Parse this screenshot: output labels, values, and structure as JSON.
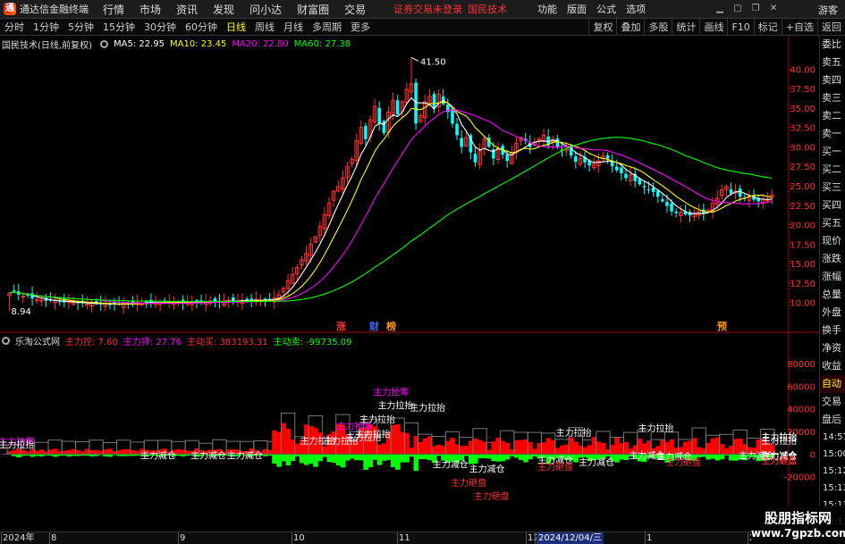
{
  "topbar": {
    "app_title": "通达信金融终端",
    "menus": [
      "行情",
      "市场",
      "资讯",
      "发现",
      "问小达",
      "财富圈",
      "交易"
    ],
    "notice": "证券交易未登录",
    "stock_name": "国民技术",
    "right_menus": [
      "功能",
      "版面",
      "公式",
      "选项"
    ],
    "guest": "游客",
    "brand_color": "#ff3030"
  },
  "toolbar": {
    "periods": [
      "分时",
      "1分钟",
      "5分钟",
      "15分钟",
      "30分钟",
      "60分钟",
      "日线",
      "周线",
      "月线",
      "多周期",
      "更多"
    ],
    "active_period": "日线",
    "right_buttons": [
      "复权",
      "叠加",
      "多股",
      "统计",
      "画线",
      "F10",
      "标记",
      "+自选",
      "返回"
    ]
  },
  "main_info": {
    "label": "国民技术(日线,前复权)",
    "ma5": "MA5: 22.95",
    "ma10": "MA10: 23.45",
    "ma20": "MA20: 22.80",
    "ma60": "MA60: 27.38",
    "colors": {
      "ma5": "#ffffff",
      "ma10": "#ffff00",
      "ma20": "#ff00ff",
      "ma60": "#00ff00"
    }
  },
  "sub_info": {
    "label": "乐淘公式网",
    "zlk": "主力控: 7.60",
    "zlp": "主力排: 27.76",
    "zdm": "主动买: 383193.31",
    "zdmc": "主动卖: -99735.09",
    "colors": {
      "zlk": "#ff3030",
      "zlp": "#ff00ff",
      "zdm": "#ff3030",
      "zdmc": "#00ff00"
    }
  },
  "chart_data": [
    {
      "type": "candlestick",
      "title": "国民技术(日线,前复权)",
      "ylim": [
        8,
        42
      ],
      "yticks": [
        "40.00",
        "37.50",
        "35.00",
        "32.50",
        "30.00",
        "27.50",
        "25.00",
        "22.50",
        "20.00",
        "17.50",
        "15.00",
        "12.50",
        "10.00"
      ],
      "price_high_label": "41.50",
      "price_low_label": "8.94",
      "event_markers": [
        {
          "label": "涨",
          "color": "#ff3030",
          "date": "2024-10"
        },
        {
          "label": "财",
          "color": "#3070ff",
          "date": "2024-10"
        },
        {
          "label": "榜",
          "color": "#ff9900",
          "date": "2024-10"
        },
        {
          "label": "预",
          "color": "#ff9900",
          "date": "2025-01"
        }
      ],
      "closes": [
        11.2,
        11.5,
        11.0,
        10.8,
        10.9,
        10.5,
        10.4,
        10.3,
        10.2,
        10.3,
        10.2,
        10.1,
        10.0,
        10.1,
        10.0,
        9.9,
        9.9,
        9.8,
        9.9,
        9.8,
        9.8,
        9.9,
        9.7,
        9.8,
        9.7,
        9.9,
        9.8,
        9.9,
        10.0,
        9.9,
        10.1,
        10.0,
        9.9,
        9.9,
        10.0,
        10.1,
        9.9,
        10.0,
        9.9,
        10.0,
        10.1,
        10.0,
        10.0,
        10.1,
        10.2,
        10.1,
        10.0,
        10.2,
        10.3,
        10.1,
        10.2,
        10.3,
        10.2,
        10.3,
        10.4,
        10.2,
        10.3,
        10.4,
        10.6,
        11.0,
        11.8,
        12.8,
        13.6,
        14.5,
        15.5,
        16.3,
        17.5,
        18.4,
        19.8,
        21.3,
        22.8,
        24.3,
        24.9,
        26.0,
        27.5,
        28.4,
        30.8,
        32.5,
        31.0,
        33.5,
        35.2,
        33.0,
        31.8,
        34.5,
        36.0,
        34.2,
        35.8,
        37.4,
        38.1,
        33.0,
        34.0,
        35.8,
        36.5,
        35.0,
        36.8,
        35.5,
        34.5,
        33.0,
        31.5,
        30.0,
        31.2,
        29.3,
        28.0,
        29.5,
        31.0,
        30.0,
        28.5,
        29.8,
        29.0,
        28.2,
        29.2,
        30.5,
        31.2,
        30.8,
        30.0,
        30.6,
        31.0,
        31.5,
        30.2,
        31.0,
        30.0,
        29.5,
        29.8,
        28.9,
        28.1,
        28.5,
        28.0,
        27.6,
        27.8,
        28.2,
        28.8,
        28.5,
        27.5,
        27.0,
        26.6,
        26.0,
        26.4,
        25.6,
        25.2,
        24.8,
        24.5,
        24.2,
        23.6,
        23.0,
        22.4,
        21.7,
        21.5,
        21.6,
        21.3,
        21.2,
        21.5,
        21.7,
        21.4,
        21.9,
        22.8,
        23.4,
        24.5,
        24.9,
        24.0,
        24.3,
        23.6,
        23.4,
        23.5,
        23.2,
        23.0,
        23.3,
        23.2,
        23.8
      ],
      "series": [
        {
          "name": "MA5",
          "color": "#ffffff"
        },
        {
          "name": "MA10",
          "color": "#ffff00"
        },
        {
          "name": "MA20",
          "color": "#ff00ff"
        },
        {
          "name": "MA60",
          "color": "#00ff00"
        }
      ]
    },
    {
      "type": "bar",
      "title": "乐淘公式网",
      "ylim": [
        -25000,
        95000
      ],
      "yticks": [
        "80000",
        "60000",
        "40000",
        "20000",
        "0",
        "-20000"
      ],
      "series": [
        {
          "name": "主动买",
          "color": "#ff0000"
        },
        {
          "name": "主动卖",
          "color": "#00ff00"
        }
      ],
      "annotations": [
        {
          "text": "主力抢筹",
          "color": "#ff00ff",
          "bar": 0,
          "value": 8000
        },
        {
          "text": "主力拉抬",
          "color": "#ffffff",
          "bar": 0,
          "value": 5500
        },
        {
          "text": "主力减仓",
          "color": "#ffffff",
          "bar": 31,
          "value": -4000
        },
        {
          "text": "主力减仓",
          "color": "#ffffff",
          "bar": 42,
          "value": -4000
        },
        {
          "text": "主力减仓",
          "color": "#ffffff",
          "bar": 50,
          "value": -4000
        },
        {
          "text": "主力拉抬",
          "color": "#ffffff",
          "bar": 66,
          "value": 9000
        },
        {
          "text": "主力拉抬",
          "color": "#ffffff",
          "bar": 71,
          "value": 9000
        },
        {
          "text": "主力抢筹",
          "color": "#ff00ff",
          "bar": 74,
          "value": 22000
        },
        {
          "text": "主力拉抬",
          "color": "#ffffff",
          "bar": 76,
          "value": 12000
        },
        {
          "text": "主力拉抬",
          "color": "#ffffff",
          "bar": 79,
          "value": 28000
        },
        {
          "text": "主力拉抬",
          "color": "#ffffff",
          "bar": 83,
          "value": 40000
        },
        {
          "text": "主力拉抬",
          "color": "#ffffff",
          "bar": 90,
          "value": 38000
        },
        {
          "text": "主力拉抬",
          "color": "#ffffff",
          "bar": 78,
          "value": 15000
        },
        {
          "text": "主力抢筹",
          "color": "#ff00ff",
          "bar": 82,
          "value": 52000
        },
        {
          "text": "主力减仓",
          "color": "#ffffff",
          "bar": 95,
          "value": -12000
        },
        {
          "text": "主力减仓",
          "color": "#ffffff",
          "bar": 103,
          "value": -16000
        },
        {
          "text": "主力砸盘",
          "color": "#ff3030",
          "bar": 99,
          "value": -28000
        },
        {
          "text": "主力砸盘",
          "color": "#ff3030",
          "bar": 104,
          "value": -40000
        },
        {
          "text": "主力拉抬",
          "color": "#ffffff",
          "bar": 122,
          "value": 16000
        },
        {
          "text": "主力减仓",
          "color": "#ffffff",
          "bar": 118,
          "value": -8000
        },
        {
          "text": "主力砸盘",
          "color": "#ff3030",
          "bar": 118,
          "value": -14000
        },
        {
          "text": "主力减仓",
          "color": "#ffffff",
          "bar": 127,
          "value": -10000
        },
        {
          "text": "主力拉抬",
          "color": "#ffffff",
          "bar": 140,
          "value": 20000
        },
        {
          "text": "主力减仓",
          "color": "#ffffff",
          "bar": 138,
          "value": -4000
        },
        {
          "text": "主力减仓",
          "color": "#ffffff",
          "bar": 144,
          "value": -5000
        },
        {
          "text": "主力砸盘",
          "color": "#ff3030",
          "bar": 146,
          "value": -10000
        },
        {
          "text": "主力减仓",
          "color": "#ffffff",
          "bar": 162,
          "value": -4000
        },
        {
          "text": "主力减仓",
          "color": "#ffffff",
          "bar": 170,
          "value": -5000
        },
        {
          "text": "主力砸盘",
          "color": "#ff3030",
          "bar": 172,
          "value": -9000
        },
        {
          "text": "主力拉抬",
          "color": "#ffffff",
          "bar": 175,
          "value": 9000
        },
        {
          "text": "主力拉抬",
          "color": "#ffffff",
          "bar": 184,
          "value": 12000
        },
        {
          "text": "主力拉抬",
          "color": "#ffffff",
          "bar": 190,
          "value": 12000
        },
        {
          "text": "主力减仓",
          "color": "#ffffff",
          "bar": 200,
          "value": -4000
        },
        {
          "text": "主力砸盘",
          "color": "#ff3030",
          "bar": 200,
          "value": -9000
        }
      ]
    }
  ],
  "rpanel": {
    "items": [
      "委比",
      "卖五",
      "卖四",
      "卖三",
      "卖二",
      "卖一",
      "买一",
      "买二",
      "买三",
      "买四",
      "买五",
      "现价",
      "涨跌",
      "涨幅",
      "总量",
      "外盘",
      "换手",
      "净资",
      "收益"
    ],
    "auto_label": "自动",
    "trade_label": "交易",
    "after_label": "盘后",
    "times": [
      "14:57",
      "15:00",
      "15:12",
      "15:13",
      "15:13",
      "15:13",
      "15:13"
    ]
  },
  "xaxis": {
    "labels": [
      "2024年",
      "8",
      "9",
      "10",
      "11",
      "12",
      "2024/12/04/三",
      "1",
      "2"
    ],
    "highlighted": "2024/12/04/三"
  },
  "watermark": {
    "line1": "股朋指标网",
    "line2": "www.7gpzb.com"
  }
}
